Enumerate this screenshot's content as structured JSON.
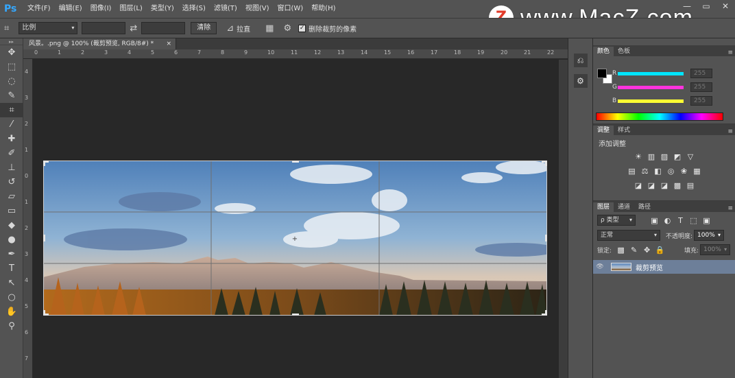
{
  "app": {
    "logo": "Ps"
  },
  "menu": [
    "文件(F)",
    "编辑(E)",
    "图像(I)",
    "图层(L)",
    "类型(Y)",
    "选择(S)",
    "滤镜(T)",
    "视图(V)",
    "窗口(W)",
    "帮助(H)"
  ],
  "watermark": {
    "badge": "Z",
    "text": "www.MacZ.com"
  },
  "window_controls": {
    "minimize": "—",
    "maximize": "▭",
    "close": "✕"
  },
  "options": {
    "tool_icon": "crop-icon",
    "ratio_value": "比例",
    "swap_icon": "swap-icon",
    "clear_label": "清除",
    "straighten_label": "拉直",
    "delete_pixels_label": "删除裁剪的像素",
    "delete_pixels_checked": true
  },
  "document": {
    "tab_title": "风景。.png @ 100% (裁剪预览, RGB/8#) *",
    "close": "×"
  },
  "ruler": {
    "top": [
      "0",
      "1",
      "2",
      "3",
      "4",
      "5",
      "6",
      "7",
      "8",
      "9",
      "10",
      "11",
      "12",
      "13",
      "14",
      "15",
      "16",
      "17",
      "18",
      "19",
      "20",
      "21",
      "22"
    ],
    "left": [
      "4",
      "3",
      "2",
      "1",
      "0",
      "1",
      "2",
      "3",
      "4",
      "5",
      "6",
      "7"
    ]
  },
  "tools": [
    {
      "name": "move-tool-icon",
      "glyph": "✥"
    },
    {
      "name": "marquee-tool-icon",
      "glyph": "⬚"
    },
    {
      "name": "lasso-tool-icon",
      "glyph": "◌"
    },
    {
      "name": "quick-select-tool-icon",
      "glyph": "✎"
    },
    {
      "name": "crop-tool-icon",
      "glyph": "⌗",
      "active": true
    },
    {
      "name": "eyedropper-tool-icon",
      "glyph": "⁄"
    },
    {
      "name": "healing-tool-icon",
      "glyph": "✚"
    },
    {
      "name": "brush-tool-icon",
      "glyph": "✐"
    },
    {
      "name": "stamp-tool-icon",
      "glyph": "⊥"
    },
    {
      "name": "history-brush-tool-icon",
      "glyph": "↺"
    },
    {
      "name": "eraser-tool-icon",
      "glyph": "▱"
    },
    {
      "name": "gradient-tool-icon",
      "glyph": "▭"
    },
    {
      "name": "blur-tool-icon",
      "glyph": "◆"
    },
    {
      "name": "dodge-tool-icon",
      "glyph": "●"
    },
    {
      "name": "pen-tool-icon",
      "glyph": "✒"
    },
    {
      "name": "type-tool-icon",
      "glyph": "T"
    },
    {
      "name": "path-select-tool-icon",
      "glyph": "↖"
    },
    {
      "name": "shape-tool-icon",
      "glyph": "○"
    },
    {
      "name": "hand-tool-icon",
      "glyph": "✋"
    },
    {
      "name": "zoom-tool-icon",
      "glyph": "⚲"
    }
  ],
  "color_panel": {
    "tabs": [
      "颜色",
      "色板"
    ],
    "active_tab": 0,
    "channels": [
      {
        "label": "R",
        "value": "255",
        "color": "#00e5ff"
      },
      {
        "label": "G",
        "value": "255",
        "color": "#ff33dd"
      },
      {
        "label": "B",
        "value": "255",
        "color": "#ffff33"
      }
    ],
    "foreground": "#000000",
    "background": "#ffffff"
  },
  "adjust_panel": {
    "tabs": [
      "调整",
      "样式"
    ],
    "active_tab": 0,
    "title": "添加调整",
    "rows": [
      [
        "☀",
        "▥",
        "▨",
        "◩",
        "▽"
      ],
      [
        "▤",
        "⚖",
        "◧",
        "◎",
        "❀",
        "▦"
      ],
      [
        "◪",
        "◪",
        "◪",
        "▩",
        "▤"
      ]
    ]
  },
  "layers_panel": {
    "tabs": [
      "图层",
      "通道",
      "路径"
    ],
    "active_tab": 0,
    "filter_label": "ρ 类型",
    "filter_icons": [
      "▣",
      "◐",
      "T",
      "⬚",
      "▣"
    ],
    "blend_mode": "正常",
    "opacity_label": "不透明度:",
    "opacity_value": "100%",
    "lock_label": "锁定:",
    "lock_icons": [
      "▩",
      "✎",
      "✥",
      "🔒"
    ],
    "fill_label": "填充:",
    "fill_value": "100%",
    "layers": [
      {
        "name": "裁剪预览",
        "visible": true,
        "selected": true
      }
    ]
  }
}
